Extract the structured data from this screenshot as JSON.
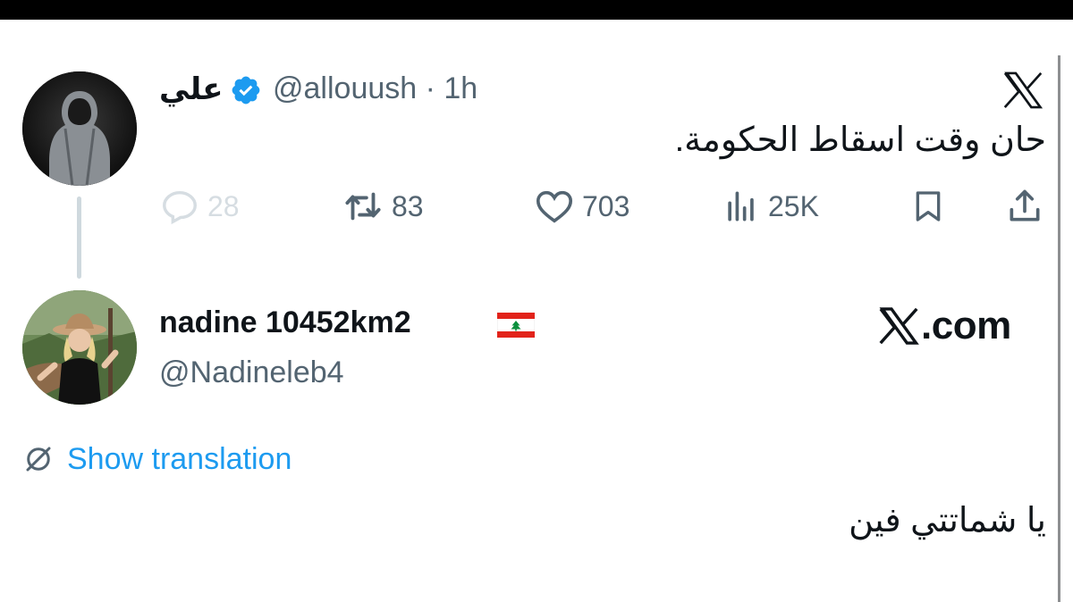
{
  "tweet1": {
    "display_name": "علي",
    "handle_time": "@allouush · 1h",
    "text": "حان وقت اسقاط الحكومة.",
    "stats": {
      "replies": "28",
      "retweets": "83",
      "likes": "703",
      "views": "25K"
    }
  },
  "tweet2": {
    "display_name": "nadine 10452km2",
    "handle": "@Nadineleb4",
    "site_label": ".com",
    "translate_label": "Show translation",
    "text": "يا شماتتي فين"
  },
  "icons": {
    "verified": "verified-badge-icon",
    "reply": "reply-icon",
    "retweet": "retweet-icon",
    "like": "heart-icon",
    "views": "views-icon",
    "bookmark": "bookmark-icon",
    "share": "share-icon",
    "x_logo": "x-logo-icon",
    "flag": "lebanon-flag-icon",
    "translate": "translate-icon"
  },
  "colors": {
    "verified_blue": "#1d9bf0",
    "link_blue": "#1d9bf0",
    "secondary_gray": "#536471",
    "text": "#0f1419"
  }
}
